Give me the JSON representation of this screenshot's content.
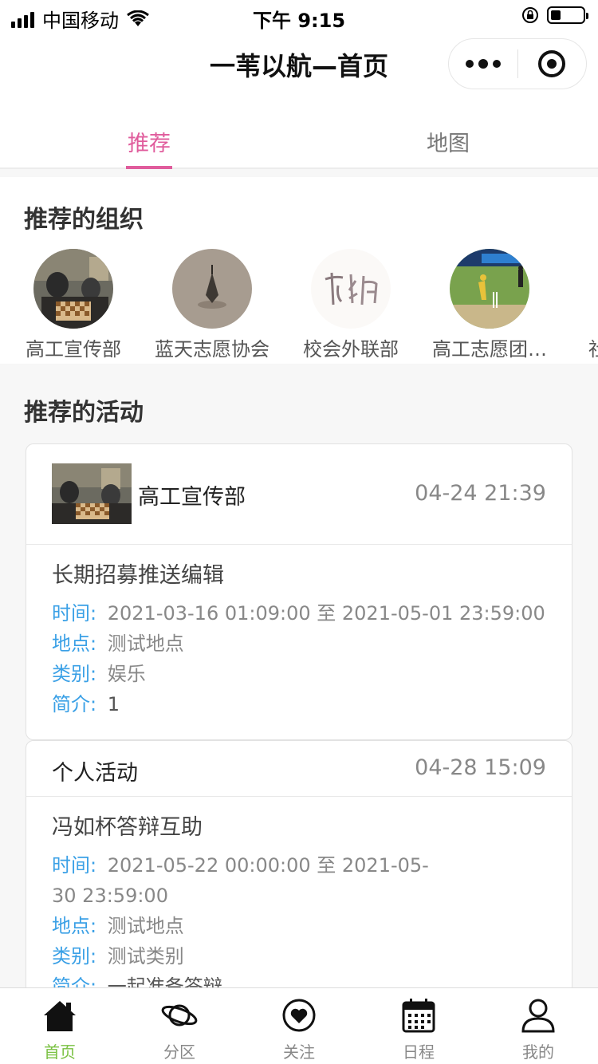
{
  "status_bar": {
    "carrier": "中国移动",
    "time": "下午 9:15",
    "battery_level": 0.3
  },
  "nav": {
    "title": "一苇以航—首页"
  },
  "tabs": [
    {
      "label": "推荐",
      "active": true
    },
    {
      "label": "地图",
      "active": false
    }
  ],
  "orgs": {
    "title": "推荐的组织",
    "items": [
      {
        "name": "高工宣传部"
      },
      {
        "name": "蓝天志愿协会"
      },
      {
        "name": "校会外联部"
      },
      {
        "name": "高工志愿团…"
      },
      {
        "name": "社"
      }
    ]
  },
  "activities": {
    "title": "推荐的活动",
    "items": [
      {
        "org": "高工宣传部",
        "date": "04-24 21:39",
        "title": "长期招募推送编辑",
        "time_label": "时间:",
        "time_value": "2021-03-16 01:09:00 至 2021-05-01 23:59:00",
        "place_label": "地点:",
        "place_value": "测试地点",
        "category_label": "类别:",
        "category_value": "娱乐",
        "intro_label": "简介:",
        "intro_value": "1"
      },
      {
        "org": "个人活动",
        "date": "04-28 15:09",
        "title": "冯如杯答辩互助",
        "time_label": "时间:",
        "time_value": "2021-05-22 00:00:00 至 2021-05-30 23:59:00",
        "place_label": "地点:",
        "place_value": "测试地点",
        "category_label": "类别:",
        "category_value": "测试类别",
        "intro_label": "简介:",
        "intro_value": "一起准备答辩"
      }
    ]
  },
  "tabbar": [
    {
      "label": "首页",
      "icon": "home-icon",
      "active": true
    },
    {
      "label": "分区",
      "icon": "planet-icon",
      "active": false
    },
    {
      "label": "关注",
      "icon": "heart-icon",
      "active": false
    },
    {
      "label": "日程",
      "icon": "calendar-icon",
      "active": false
    },
    {
      "label": "我的",
      "icon": "user-icon",
      "active": false
    }
  ],
  "colors": {
    "accent_pink": "#e05c9c",
    "label_blue": "#3aa0e6",
    "tab_active_green": "#7ac142"
  }
}
